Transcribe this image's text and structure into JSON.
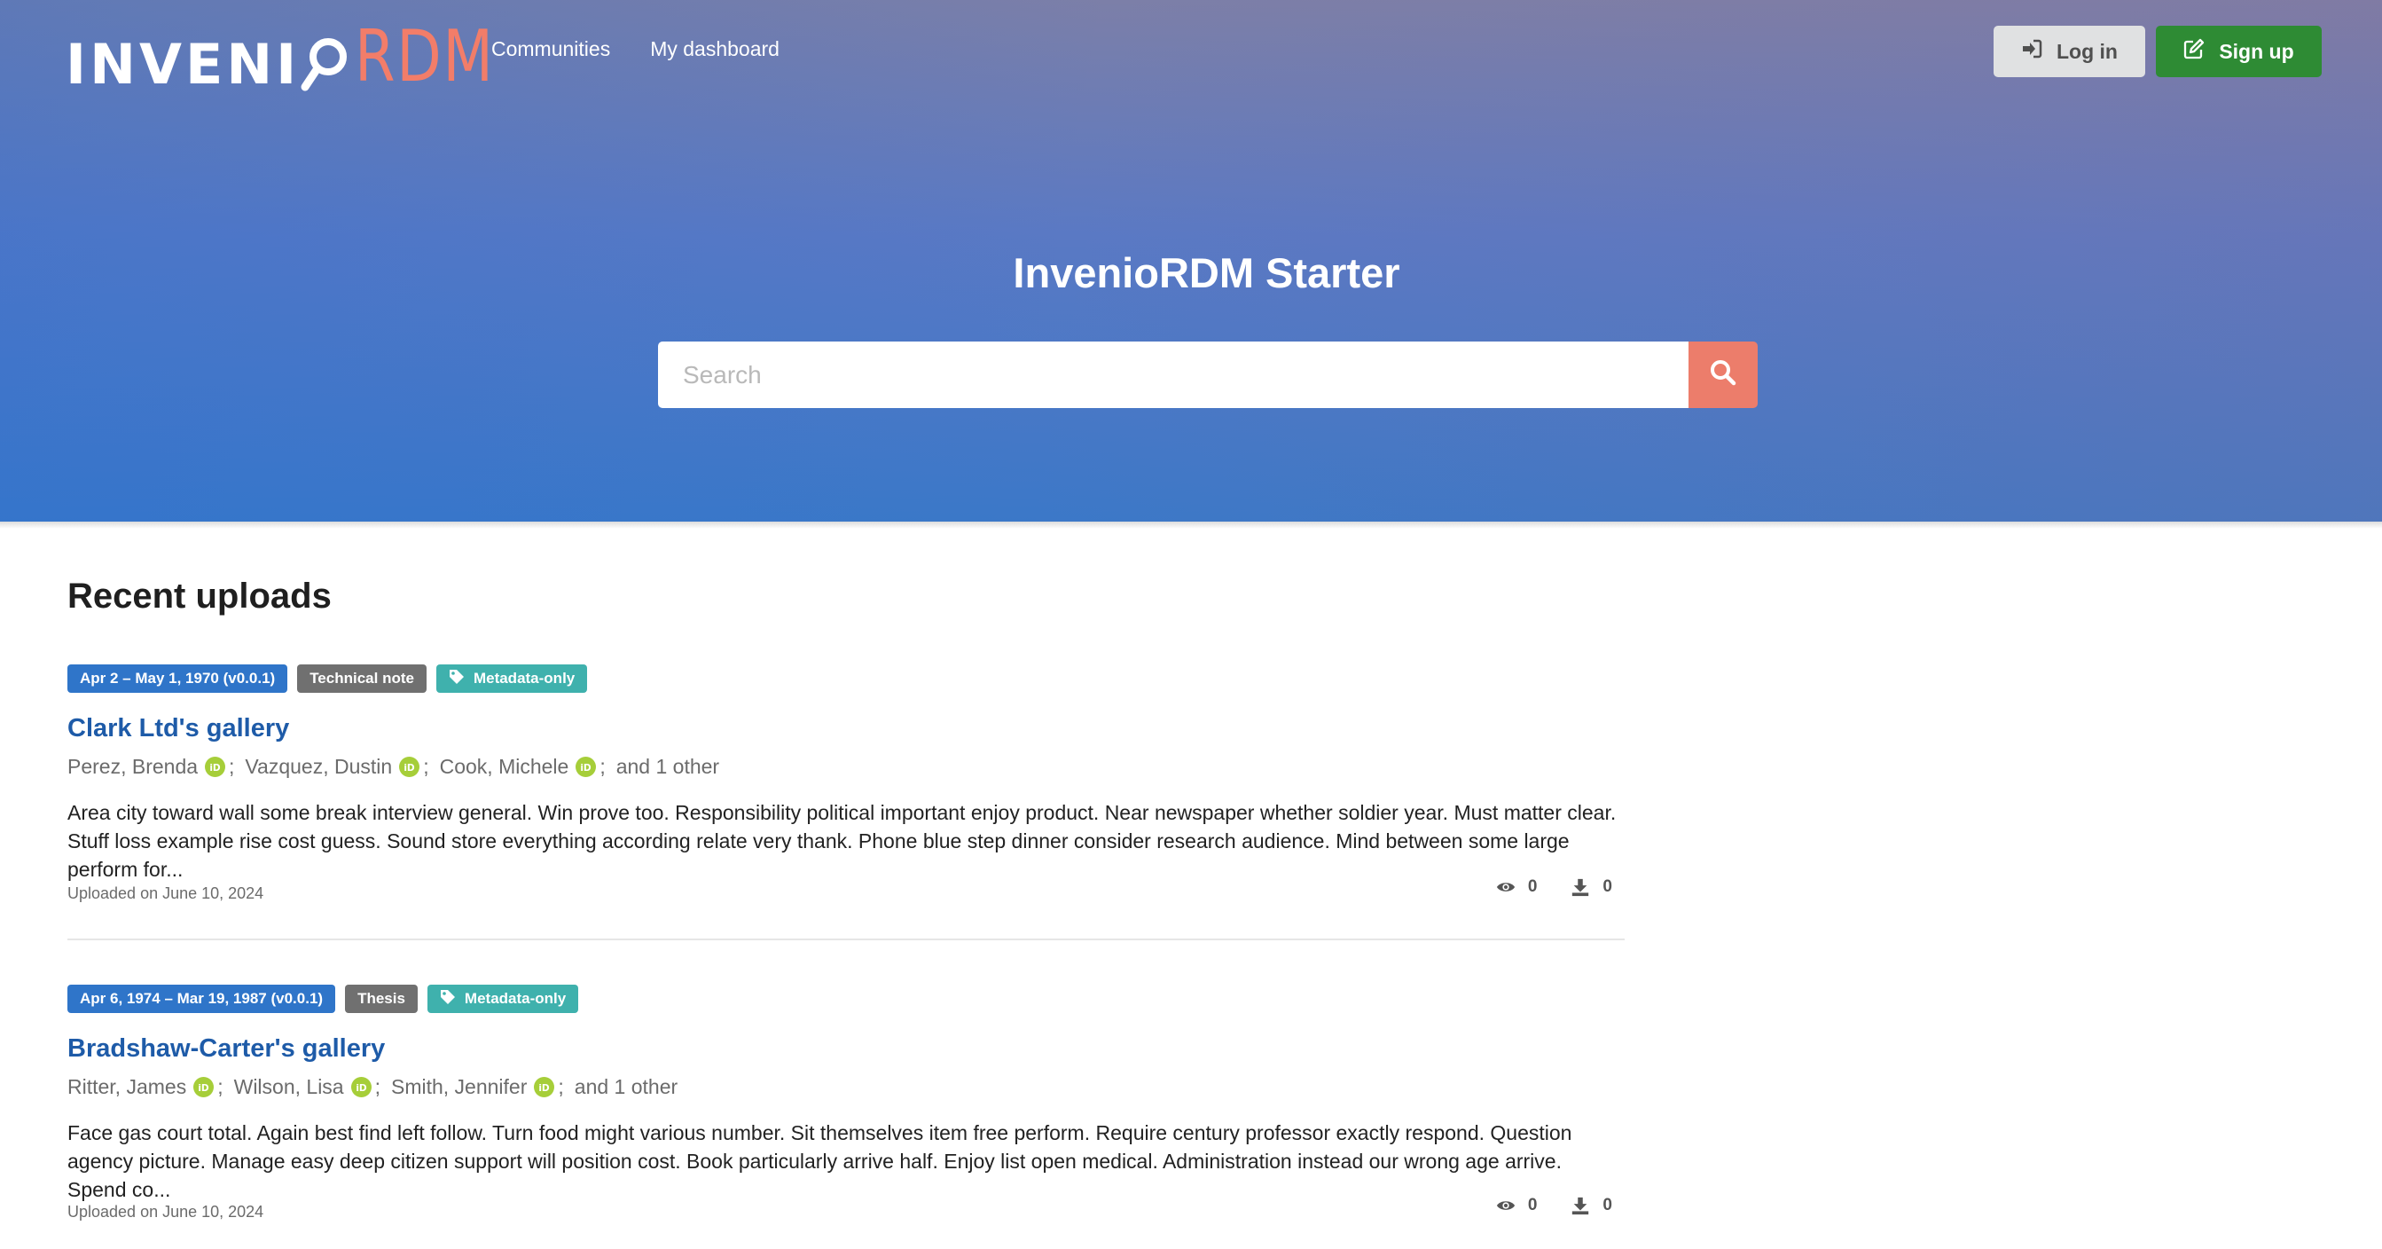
{
  "brand": {
    "name_part1": "INVENI",
    "name_part2": "RDM"
  },
  "nav": {
    "items": [
      {
        "label": "Communities"
      },
      {
        "label": "My dashboard"
      }
    ]
  },
  "auth": {
    "login_label": "Log in",
    "signup_label": "Sign up"
  },
  "hero": {
    "title": "InvenioRDM Starter"
  },
  "search": {
    "placeholder": "Search"
  },
  "main": {
    "section_title": "Recent uploads",
    "records": [
      {
        "date_label": "Apr 2 – May 1, 1970 (v0.0.1)",
        "type_label": "Technical note",
        "access_label": "Metadata-only",
        "title": "Clark Ltd's gallery",
        "creators": [
          "Perez, Brenda",
          "Vazquez, Dustin",
          "Cook, Michele"
        ],
        "more": "and 1 other",
        "description": "Area city toward wall some break interview general. Win prove too. Responsibility political important enjoy product. Near newspaper whether soldier year. Must matter clear. Stuff loss example rise cost guess. Sound store everything according relate very thank. Phone blue step dinner consider research audience. Mind between some large perform for...",
        "uploaded": "Uploaded on June 10, 2024",
        "views": "0",
        "downloads": "0"
      },
      {
        "date_label": "Apr 6, 1974 – Mar 19, 1987 (v0.0.1)",
        "type_label": "Thesis",
        "access_label": "Metadata-only",
        "title": "Bradshaw-Carter's gallery",
        "creators": [
          "Ritter, James",
          "Wilson, Lisa",
          "Smith, Jennifer"
        ],
        "more": "and 1 other",
        "description": "Face gas court total. Again best find left follow. Turn food might various number. Sit themselves item free perform. Require century professor exactly respond. Question agency picture. Manage easy deep citizen support will position cost. Book particularly arrive half. Enjoy list open medical. Administration instead our wrong age arrive. Spend co...",
        "uploaded": "Uploaded on June 10, 2024",
        "views": "0",
        "downloads": "0"
      }
    ]
  },
  "colors": {
    "accent": "#ec7d6b",
    "brand_secondary": "#f27d69",
    "signup": "#2e8b34",
    "date_label": "#2f75c9",
    "type_label": "#707070",
    "access_label": "#3fb1ad",
    "link": "#1e5ba8",
    "orcid": "#a6ce39"
  },
  "icons": {
    "login": "sign-in-icon",
    "signup": "edit-icon",
    "search": "search-icon",
    "access": "tag-icon",
    "orcid": "orcid-icon",
    "views": "eye-icon",
    "downloads": "download-icon"
  }
}
